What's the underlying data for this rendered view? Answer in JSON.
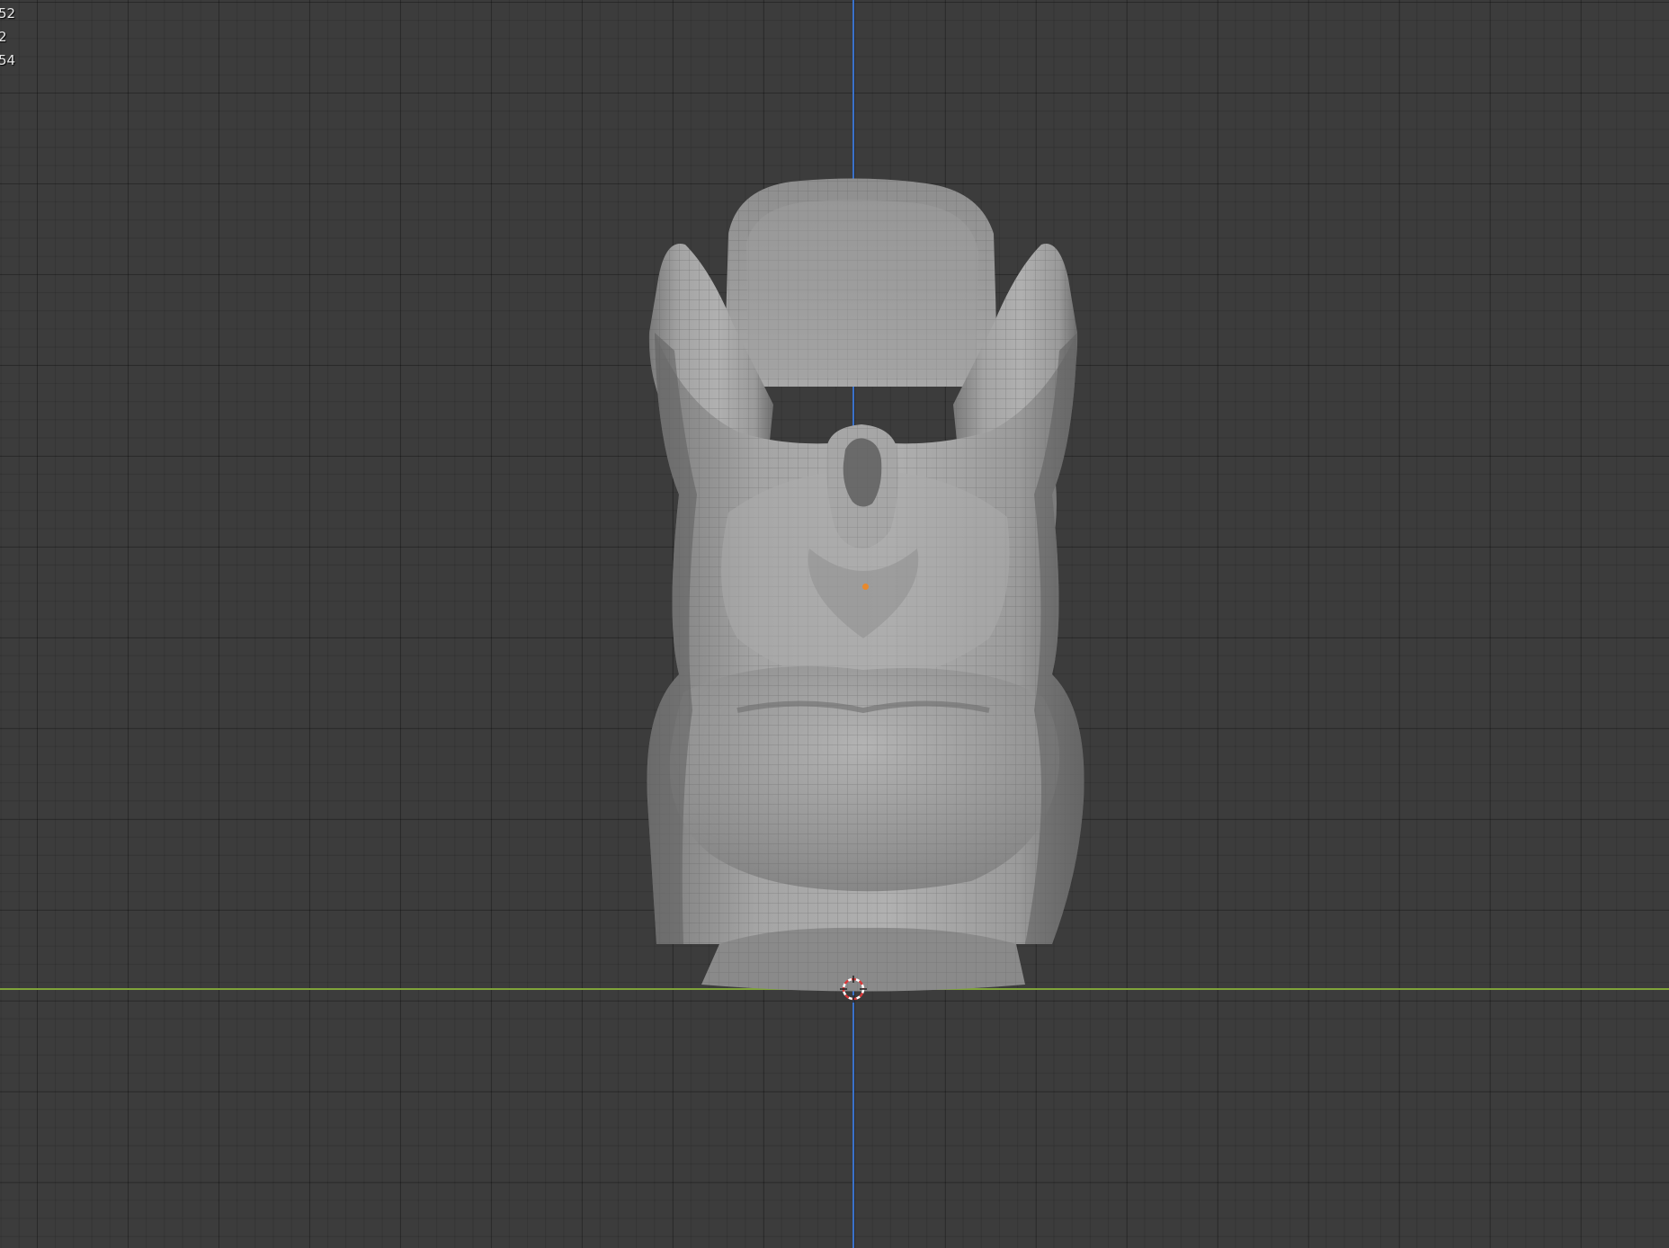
{
  "viewport": {
    "overlay_stats": [
      {
        "value": "52"
      },
      {
        "value": "2"
      },
      {
        "value": "54"
      }
    ],
    "colors": {
      "background": "#3c3c3c",
      "z_axis": "#3a71c9",
      "y_axis": "#7fa33a",
      "mesh_fill": "#9c9c9c",
      "mesh_wire": "#5b5b5b",
      "cursor_red": "#d8393a",
      "origin": "#e8892c"
    },
    "icons": {
      "cursor": "3d-cursor-icon",
      "origin": "object-origin-icon"
    }
  }
}
